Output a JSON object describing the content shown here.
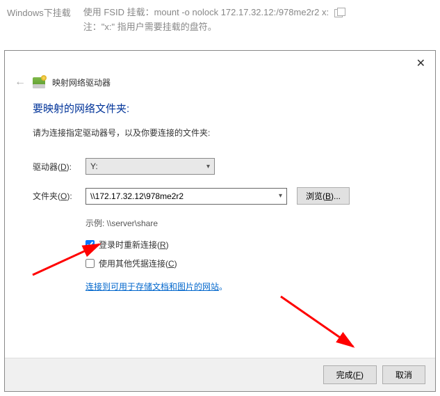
{
  "top": {
    "left_label": "Windows下挂载",
    "line1": "使用 FSID 挂载：mount -o nolock 172.17.32.12:/978me2r2 x:",
    "line2": "注：\"x:\" 指用户需要挂载的盘符。"
  },
  "dialog": {
    "title": "映射网络驱动器",
    "heading": "要映射的网络文件夹:",
    "instruction": "请为连接指定驱动器号，以及你要连接的文件夹:",
    "drive_label_pre": "驱动器(",
    "drive_label_key": "D",
    "drive_label_post": "):",
    "drive_value": "Y:",
    "folder_label_pre": "文件夹(",
    "folder_label_key": "O",
    "folder_label_post": "):",
    "folder_value": "\\\\172.17.32.12\\978me2r2",
    "browse_pre": "浏览(",
    "browse_key": "B",
    "browse_post": ")...",
    "example": "示例: \\\\server\\share",
    "reconnect_pre": "登录时重新连接(",
    "reconnect_key": "R",
    "reconnect_post": ")",
    "reconnect_checked": "true",
    "othercred_pre": "使用其他凭据连接(",
    "othercred_key": "C",
    "othercred_post": ")",
    "othercred_checked": "false",
    "link_text": "连接到可用于存储文档和图片的网站",
    "link_period": "。",
    "finish_pre": "完成(",
    "finish_key": "F",
    "finish_post": ")",
    "cancel": "取消"
  }
}
